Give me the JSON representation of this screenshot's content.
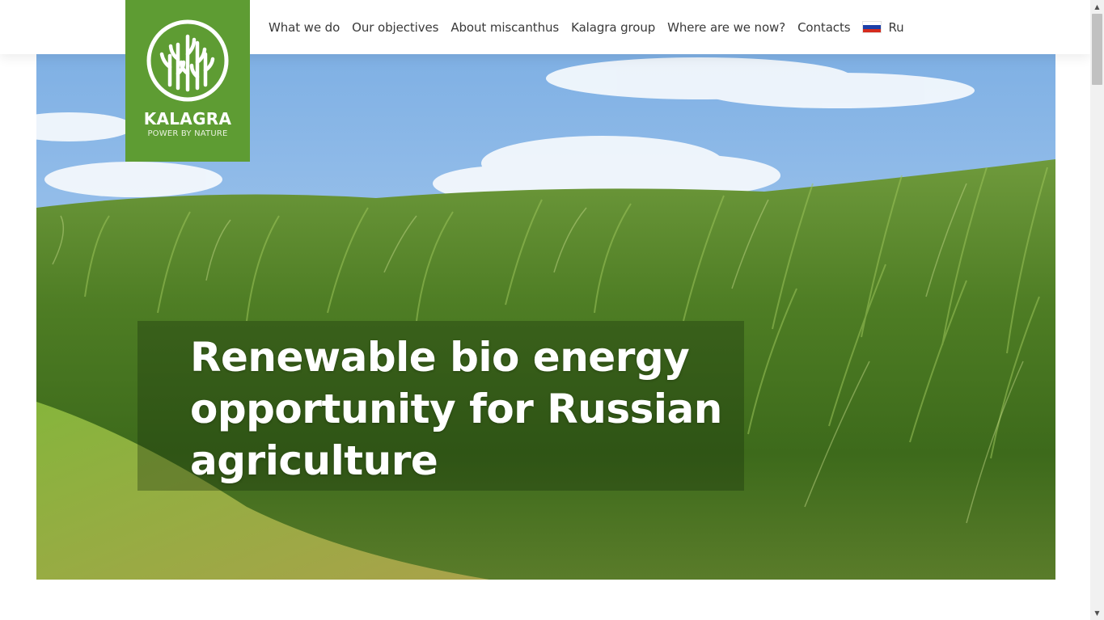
{
  "brand": {
    "name": "KALAGRA",
    "tagline": "POWER BY NATURE",
    "logo_icon": "miscanthus-emblem-icon",
    "color": "#5e9c33"
  },
  "nav": {
    "items": [
      {
        "label": "What we do"
      },
      {
        "label": "Our objectives"
      },
      {
        "label": "About miscanthus"
      },
      {
        "label": "Kalagra group"
      },
      {
        "label": "Where are we now?"
      },
      {
        "label": "Contacts"
      }
    ],
    "language": {
      "label": "Ru",
      "flag_icon": "russia-flag-icon"
    }
  },
  "hero": {
    "title": "Renewable bio energy opportunity for Russian agriculture",
    "image": "miscanthus-field-photo"
  },
  "scrollbar": {
    "up_icon": "chevron-up-icon",
    "down_icon": "chevron-down-icon"
  }
}
